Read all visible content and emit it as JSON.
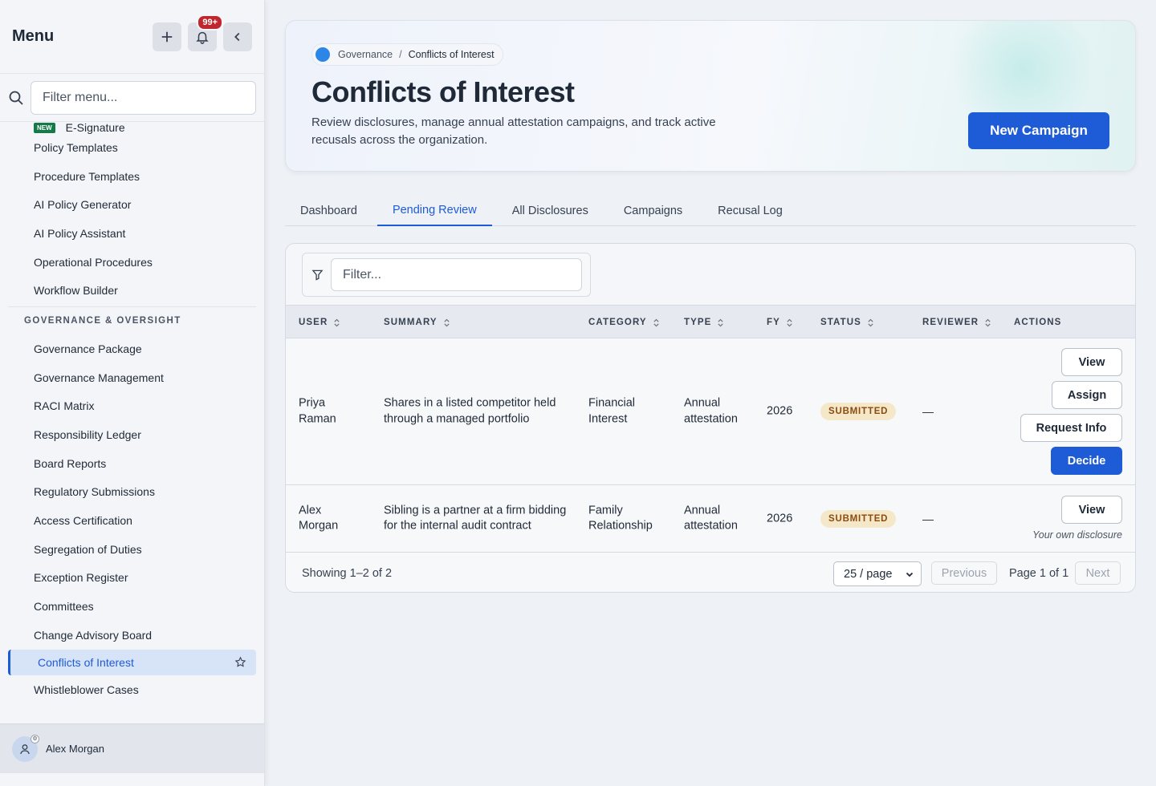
{
  "sidebar": {
    "title": "Menu",
    "notification_count": "99+",
    "search_placeholder": "Filter menu...",
    "new_tag": "NEW",
    "items_top": [
      "E-Signature",
      "Policy Templates",
      "Procedure Templates",
      "AI Policy Generator",
      "AI Policy Assistant",
      "Operational Procedures",
      "Workflow Builder"
    ],
    "section_title": "GOVERNANCE & OVERSIGHT",
    "items_section": [
      "Governance Package",
      "Governance Management",
      "RACI Matrix",
      "Responsibility Ledger",
      "Board Reports",
      "Regulatory Submissions",
      "Access Certification",
      "Segregation of Duties",
      "Exception Register",
      "Committees",
      "Change Advisory Board",
      "Conflicts of Interest",
      "Whistleblower Cases"
    ],
    "active_item": "Conflicts of Interest",
    "user_name": "Alex Morgan"
  },
  "hero": {
    "breadcrumb_parent": "Governance",
    "breadcrumb_sep": "/",
    "breadcrumb_current": "Conflicts of Interest",
    "title": "Conflicts of Interest",
    "description": "Review disclosures, manage annual attestation campaigns, and track active recusals across the organization.",
    "primary_button": "New Campaign"
  },
  "tabs": [
    "Dashboard",
    "Pending Review",
    "All Disclosures",
    "Campaigns",
    "Recusal Log"
  ],
  "active_tab": "Pending Review",
  "table": {
    "filter_placeholder": "Filter...",
    "headers": [
      "USER",
      "SUMMARY",
      "CATEGORY",
      "TYPE",
      "FY",
      "STATUS",
      "REVIEWER",
      "ACTIONS"
    ],
    "rows": [
      {
        "user": "Priya Raman",
        "summary": "Shares in a listed competitor held through a managed portfolio",
        "category": "Financial Interest",
        "type": "Annual attestation",
        "fy": "2026",
        "status": "SUBMITTED",
        "reviewer": "—",
        "actions": [
          "View",
          "Assign",
          "Request Info",
          "Decide"
        ]
      },
      {
        "user": "Alex Morgan",
        "summary": "Sibling is a partner at a firm bidding for the internal audit contract",
        "category": "Family Relationship",
        "type": "Annual attestation",
        "fy": "2026",
        "status": "SUBMITTED",
        "reviewer": "—",
        "actions": [
          "View"
        ],
        "note": "Your own disclosure"
      }
    ]
  },
  "pagination": {
    "showing": "Showing 1–2 of 2",
    "per_page": "25 / page",
    "previous": "Previous",
    "page_label": "Page 1 of 1",
    "next": "Next"
  },
  "colors": {
    "accent": "#1e5bd6",
    "status_bg": "#f5e8c8",
    "status_text": "#8a4a10",
    "new_tag": "#16794a",
    "badge": "#c0262d"
  }
}
